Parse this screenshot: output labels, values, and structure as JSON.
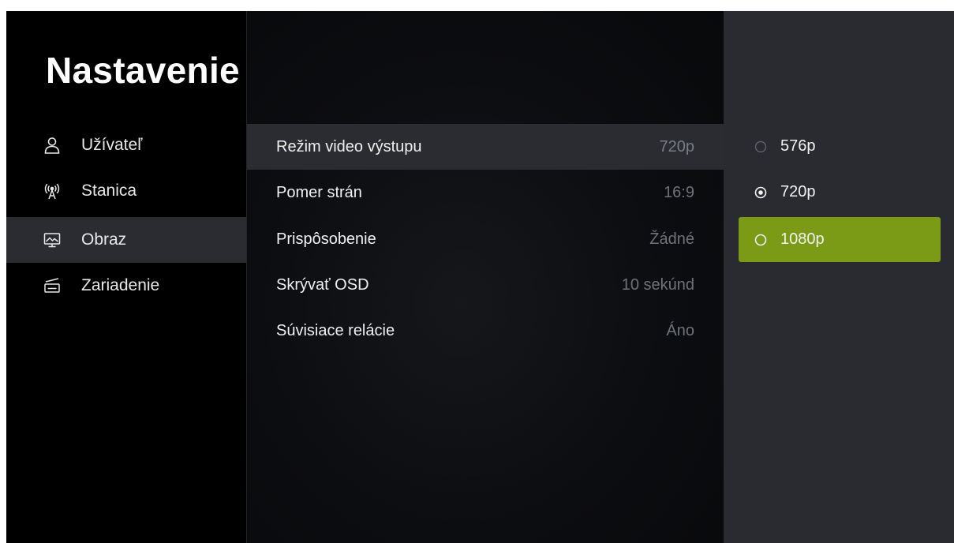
{
  "sidebar": {
    "title": "Nastavenie",
    "items": [
      {
        "label": "Užívateľ",
        "icon": "user-icon"
      },
      {
        "label": "Stanica",
        "icon": "antenna-icon"
      },
      {
        "label": "Obraz",
        "icon": "monitor-icon",
        "active": true
      },
      {
        "label": "Zariadenie",
        "icon": "device-icon"
      }
    ]
  },
  "settings": {
    "rows": [
      {
        "label": "Režim video výstupu",
        "value": "720p",
        "selected": true
      },
      {
        "label": "Pomer strán",
        "value": "16:9"
      },
      {
        "label": "Prispôsobenie",
        "value": "Žádné"
      },
      {
        "label": "Skrývať OSD",
        "value": "10 sekúnd"
      },
      {
        "label": "Súvisiace relácie",
        "value": "Áno"
      }
    ]
  },
  "options": {
    "items": [
      {
        "label": "576p",
        "checked": false
      },
      {
        "label": "720p",
        "checked": true
      },
      {
        "label": "1080p",
        "checked": false,
        "focused": true
      }
    ]
  },
  "colors": {
    "accent": "#7b9a15",
    "selection": "#2a2c31",
    "panel": "#292b30",
    "background": "#000000"
  }
}
